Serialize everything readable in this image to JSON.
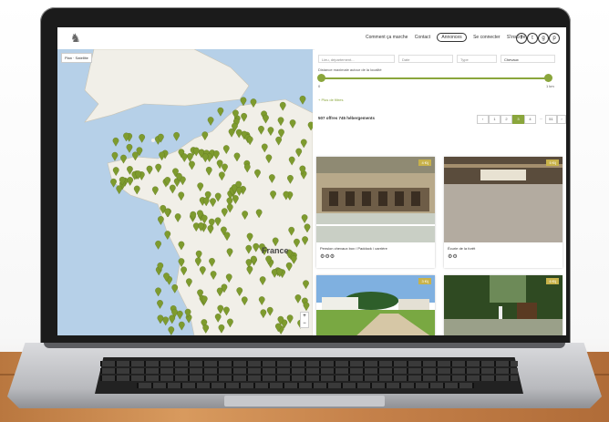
{
  "header": {
    "logo_icon": "horse-logo-icon",
    "nav": [
      {
        "label": "Comment ça marche",
        "active": false
      },
      {
        "label": "Contact",
        "active": false
      },
      {
        "label": "Annonces",
        "active": true
      },
      {
        "label": "Se connecter",
        "active": false
      },
      {
        "label": "S'inscrire",
        "active": false
      }
    ],
    "social": [
      "f",
      "t",
      "g",
      "p"
    ]
  },
  "map": {
    "button_label": "Plan · Satellite",
    "country_label": "France",
    "zoom_plus": "+",
    "zoom_minus": "−",
    "marker_color": "#7e9b2e"
  },
  "search": {
    "location_placeholder": "Lieu, département...",
    "date_placeholder": "Date",
    "type_placeholder": "Type",
    "type_value": "Chevaux",
    "slider_label": "Distance maximale autour de la localité",
    "slider_min": "0",
    "slider_max": "1 km",
    "more_filters": "+ Plus de filtres",
    "results_text": "507 offres 745 hébergements",
    "pages": [
      "‹",
      "1",
      "2",
      "3",
      "4",
      "…",
      "51",
      "›"
    ],
    "accent": "#8aa63c"
  },
  "cards": [
    {
      "caption": "Pension chevaux box / Paddock / carrière",
      "badge": "4 €/j"
    },
    {
      "caption": "Écurie de la forêt",
      "badge": "5 €/j"
    },
    {
      "caption": "",
      "badge": "3 €/j"
    },
    {
      "caption": "",
      "badge": "6 €/j"
    }
  ]
}
